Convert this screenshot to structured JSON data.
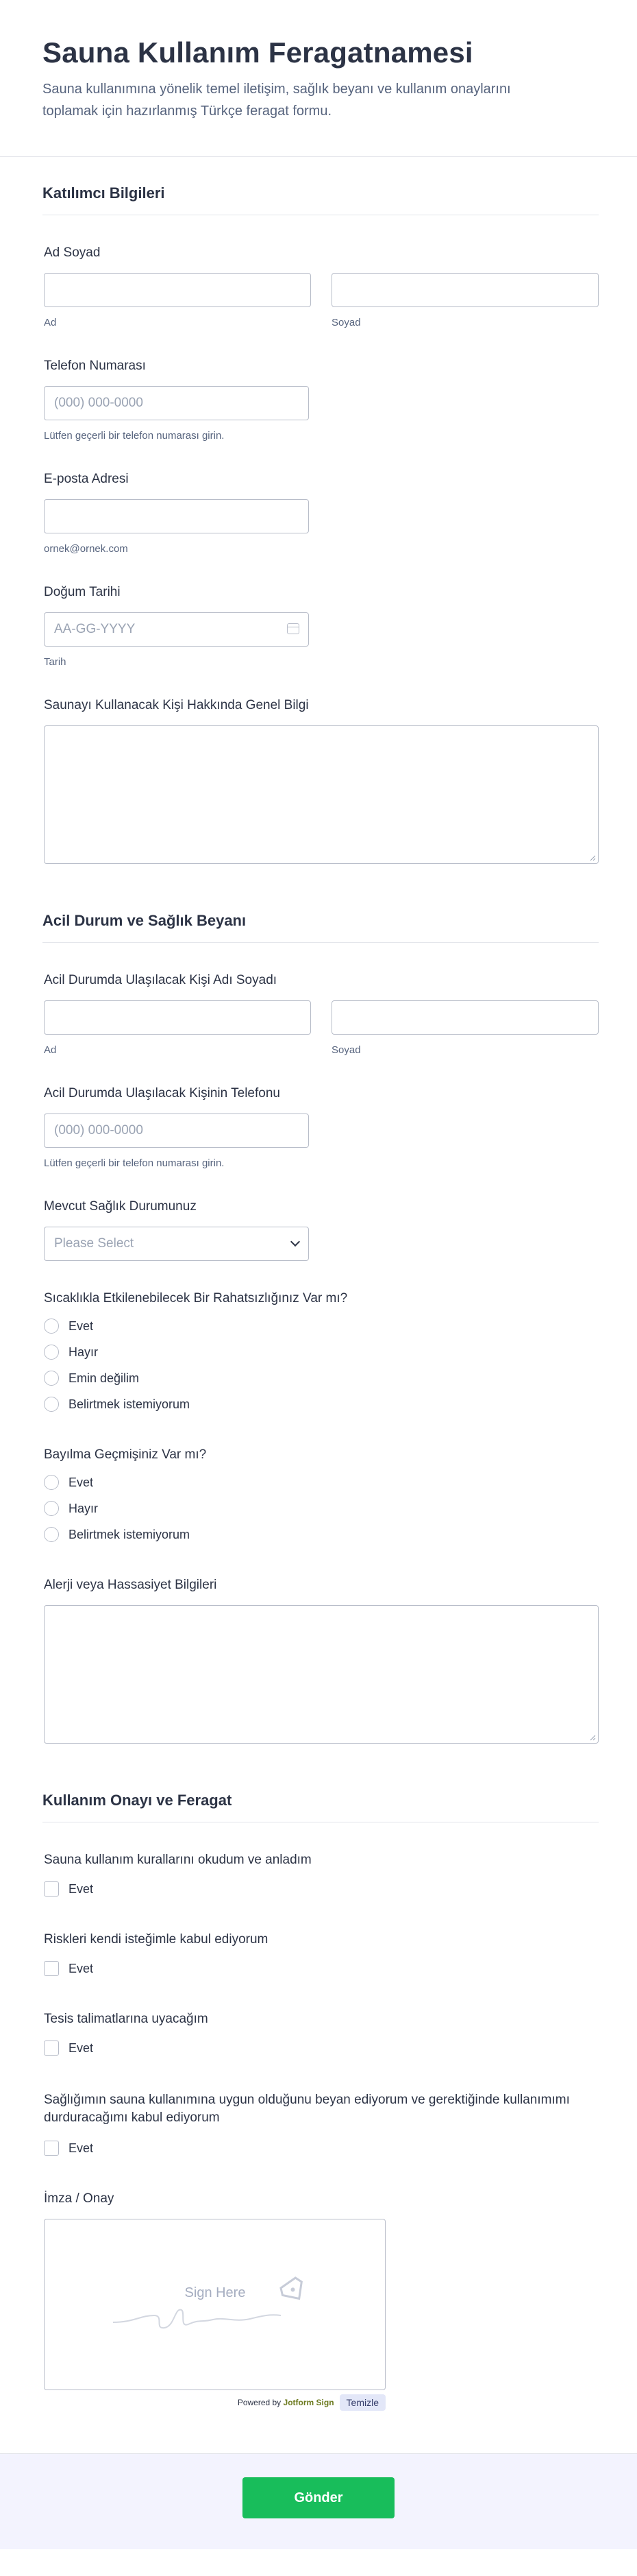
{
  "header": {
    "title": "Sauna Kullanım Feragatnamesi",
    "subtitle": "Sauna kullanımına yönelik temel iletişim, sağlık beyanı ve kullanım onaylarını toplamak için hazırlanmış Türkçe feragat formu."
  },
  "sections": {
    "participant": {
      "title": "Katılımcı Bilgileri",
      "name_label": "Ad Soyad",
      "first_sub": "Ad",
      "last_sub": "Soyad",
      "phone_label": "Telefon Numarası",
      "phone_placeholder": "(000) 000-0000",
      "phone_sub": "Lütfen geçerli bir telefon numarası girin.",
      "email_label": "E-posta Adresi",
      "email_sub": "ornek@ornek.com",
      "dob_label": "Doğum Tarihi",
      "dob_placeholder": "AA-GG-YYYY",
      "dob_sub": "Tarih",
      "info_label": "Saunayı Kullanacak Kişi Hakkında Genel Bilgi"
    },
    "health": {
      "title": "Acil Durum ve Sağlık Beyanı",
      "emergency_name_label": "Acil Durumda Ulaşılacak Kişi Adı Soyadı",
      "first_sub": "Ad",
      "last_sub": "Soyad",
      "emergency_phone_label": "Acil Durumda Ulaşılacak Kişinin Telefonu",
      "phone_placeholder": "(000) 000-0000",
      "phone_sub": "Lütfen geçerli bir telefon numarası girin.",
      "condition_label": "Mevcut Sağlık Durumunuz",
      "condition_placeholder": "Please Select",
      "heat_label": "Sıcaklıkla Etkilenebilecek Bir Rahatsızlığınız Var mı?",
      "heat_options": [
        "Evet",
        "Hayır",
        "Emin değilim",
        "Belirtmek istemiyorum"
      ],
      "faint_label": "Bayılma Geçmişiniz Var mı?",
      "faint_options": [
        "Evet",
        "Hayır",
        "Belirtmek istemiyorum"
      ],
      "allergy_label": "Alerji veya Hassasiyet Bilgileri"
    },
    "consent": {
      "title": "Kullanım Onayı ve Feragat",
      "rules_label": "Sauna kullanım kurallarını okudum ve anladım",
      "rules_option": "Evet",
      "risk_label": "Riskleri kendi isteğimle kabul ediyorum",
      "risk_option": "Evet",
      "facility_label": "Tesis talimatlarına uyacağım",
      "facility_option": "Evet",
      "health_label": "Sağlığımın sauna kullanımına uygun olduğunu beyan ediyorum ve gerektiğinde kullanımımı durduracağımı kabul ediyorum",
      "health_option": "Evet",
      "signature_label": "İmza / Onay",
      "sign_here": "Sign Here",
      "powered_by": "Powered by",
      "brand": "Jotform Sign",
      "clear": "Temizle"
    }
  },
  "submit_label": "Gönder"
}
